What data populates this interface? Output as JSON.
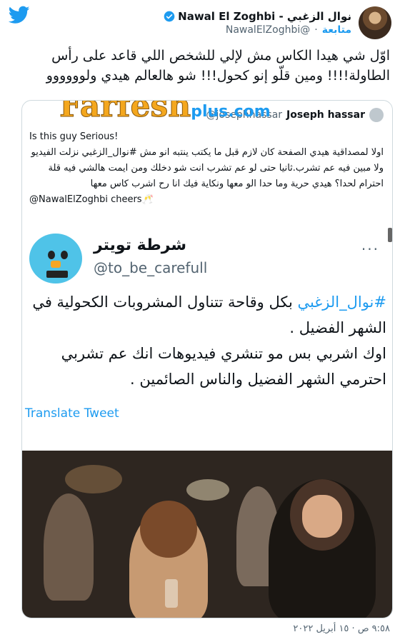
{
  "header": {
    "name": "نوال الزغبي - Nawal El Zoghbi",
    "handle": "@NawalElZoghbi",
    "separator": "·",
    "follow_label": "متابعة"
  },
  "tweet": {
    "text": "اوّل شي هيدا الكاس مش لإلي للشخص اللي قاعد على رأس الطاولة!!!! ومين قلّو إنو كحول!!! شو هالعالم هيدي ولوووووو"
  },
  "quote": {
    "watermark_main": "Farfesh",
    "watermark_suffix": "plus.com",
    "author_name": "Joseph hassar",
    "author_handle": "@josephhassar",
    "line1": "Is this guy Serious!",
    "body": "اولا لمصداقية هيدي الصفحة كان لازم قبل ما يكتب ينتبه انو مش #نوال_الزغبي نزلت الفيديو ولا مبين فيه عم تشرب.ثانيا حتى لو عم تشرب انت شو دخلك ومن ايمت هالشي فيه قلة احترام لحدا؟ هيدي حرية وما حدا الو معها ونكاية فيك انا رح اشرب كاس معها",
    "mention_line": "@NawalElZoghbi cheers🥂"
  },
  "embed": {
    "name": "شرطة تويتر",
    "handle": "@to_be_carefull",
    "hashtag": "#نوال_الزغبي",
    "text_after_hashtag": " بكل وقاحة تتناول المشروبات الكحولية في الشهر الفضيل .",
    "text_rest": "اوك اشربي بس مو تنشري فيديوهات انك عم تشربي احترمي الشهر الفضيل والناس الصائمين .",
    "more": "···",
    "translate": "Translate Tweet"
  },
  "footer": {
    "timestamp": "٩:٥٨ ص · ١٥ أبريل ٢٠٢٢"
  },
  "colors": {
    "accent": "#1d9bf0",
    "watermark": "#f4a71e"
  }
}
